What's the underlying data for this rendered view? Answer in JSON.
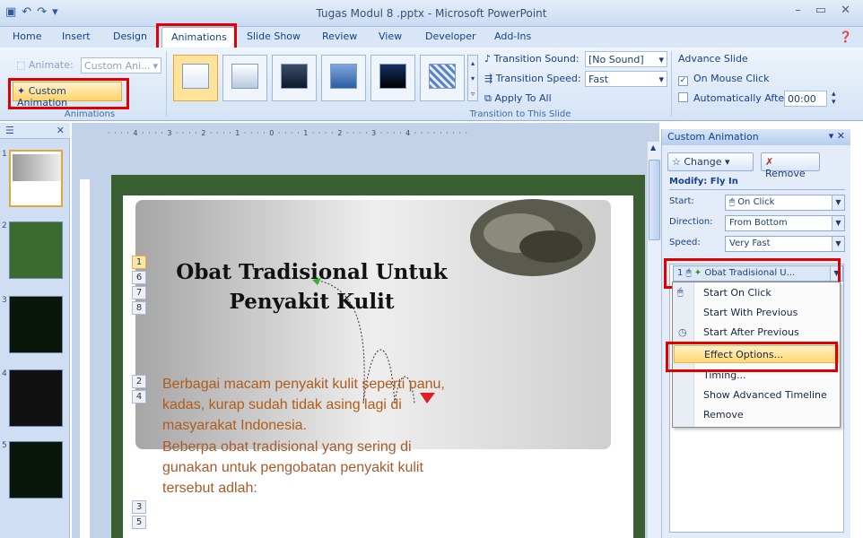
{
  "window": {
    "title": "Tugas Modul 8 .pptx - Microsoft PowerPoint",
    "controls": [
      "–",
      "▭",
      "✕"
    ]
  },
  "tabs": [
    {
      "label": "Home"
    },
    {
      "label": "Insert"
    },
    {
      "label": "Design"
    },
    {
      "label": "Animations"
    },
    {
      "label": "Slide Show"
    },
    {
      "label": "Review"
    },
    {
      "label": "View"
    },
    {
      "label": "Developer"
    },
    {
      "label": "Add-Ins"
    }
  ],
  "ribbon": {
    "animate_label": "Animate:",
    "animate_value": "Custom Ani...",
    "custom_animation_label": "Custom Animation",
    "animations_group": "Animations",
    "transition_sound_label": "Transition Sound:",
    "transition_sound_value": "[No Sound]",
    "transition_speed_label": "Transition Speed:",
    "transition_speed_value": "Fast",
    "apply_to_all": "Apply To All",
    "transition_group": "Transition to This Slide",
    "advance_slide": "Advance Slide",
    "on_mouse_click": "On Mouse Click",
    "on_mouse_click_checked": true,
    "automatically_after": "Automatically After:",
    "automatically_after_value": "00:00"
  },
  "slide": {
    "title_line1": "Obat Tradisional Untuk",
    "title_line2": "Penyakit Kulit",
    "body1_line1": "Berbagai macam penyakit kulit seperti panu,",
    "body1_line2": "kadas, kurap sudah tidak asing lagi di",
    "body1_line3": "masyarakat Indonesia.",
    "body2_line1": "Beberpa obat tradisional yang sering di",
    "body2_line2": "gunakan untuk pengobatan penyakit kulit",
    "body2_line3": "tersebut adlah:",
    "anim_numbers_title": [
      "1",
      "6",
      "7",
      "8"
    ],
    "anim_numbers_body": [
      "2",
      "4"
    ],
    "anim_numbers_body2": [
      "3",
      "5"
    ]
  },
  "pane": {
    "title": "Custom Animation",
    "change_label": "Change",
    "remove_label": "Remove",
    "modify_label": "Modify: Fly In",
    "start_label": "Start:",
    "start_value": "On Click",
    "direction_label": "Direction:",
    "direction_value": "From Bottom",
    "speed_label": "Speed:",
    "speed_value": "Very Fast",
    "item_number": "1",
    "item_label": "Obat Tradisional U..."
  },
  "context_menu": {
    "start_on_click": "Start On Click",
    "start_with_previous": "Start With Previous",
    "start_after_previous": "Start After Previous",
    "effect_options": "Effect Options...",
    "timing": "Timing...",
    "show_advanced_timeline": "Show Advanced Timeline",
    "remove": "Remove"
  },
  "slide_thumbnails": [
    "1",
    "2",
    "3",
    "4",
    "5"
  ],
  "colors": {
    "highlight_red": "#e10000",
    "slide_border_green": "#3a5f33",
    "body_text": "#b25b18",
    "ribbon_blue": "#15428b"
  }
}
